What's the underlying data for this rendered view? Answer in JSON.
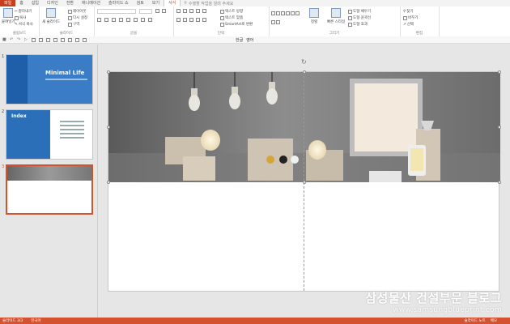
{
  "ribbon_tabs": [
    "파일",
    "홈",
    "삽입",
    "디자인",
    "전환",
    "애니메이션",
    "슬라이드 쇼",
    "검토",
    "보기",
    "서식"
  ],
  "tell_me": "수행할 작업을 알려 주세요",
  "clipboard": {
    "paste": "붙여넣기",
    "cut": "잘라내기",
    "copy": "복사",
    "format_painter": "서식 복사",
    "label": "클립보드"
  },
  "slides_group": {
    "new_slide": "새 슬라이드",
    "layout": "레이아웃",
    "reset": "다시 설정",
    "section": "구역",
    "label": "슬라이드"
  },
  "font_group": {
    "label": "글꼴"
  },
  "paragraph_group": {
    "text_direction": "텍스트 방향",
    "align_text": "텍스트 맞춤",
    "smartart": "SmartArt로 변환",
    "label": "단락"
  },
  "drawing_group": {
    "label": "그리기",
    "arrange": "정렬",
    "quick_styles": "빠른 스타일",
    "shape_fill": "도형 채우기",
    "shape_outline": "도형 윤곽선",
    "shape_effects": "도형 효과"
  },
  "editing_group": {
    "find": "찾기",
    "replace": "바꾸기",
    "select": "선택",
    "label": "편집"
  },
  "qat": {
    "font_color": "한글",
    "highlight": "영어"
  },
  "slides": [
    {
      "num": "1",
      "title": "Minimal Life"
    },
    {
      "num": "2",
      "title": "Index"
    },
    {
      "num": "3"
    }
  ],
  "status": {
    "slide_info": "슬라이드 3/3",
    "language": "한국어",
    "notes": "슬라이드 노트",
    "comments": "메모"
  },
  "watermark": {
    "line1": "삼성물산 건설부문 블로그",
    "line2": "www.samsungblueprint.com"
  },
  "colors": {
    "accent": "#d35230",
    "thumb_blue": "#2a6fb8"
  }
}
